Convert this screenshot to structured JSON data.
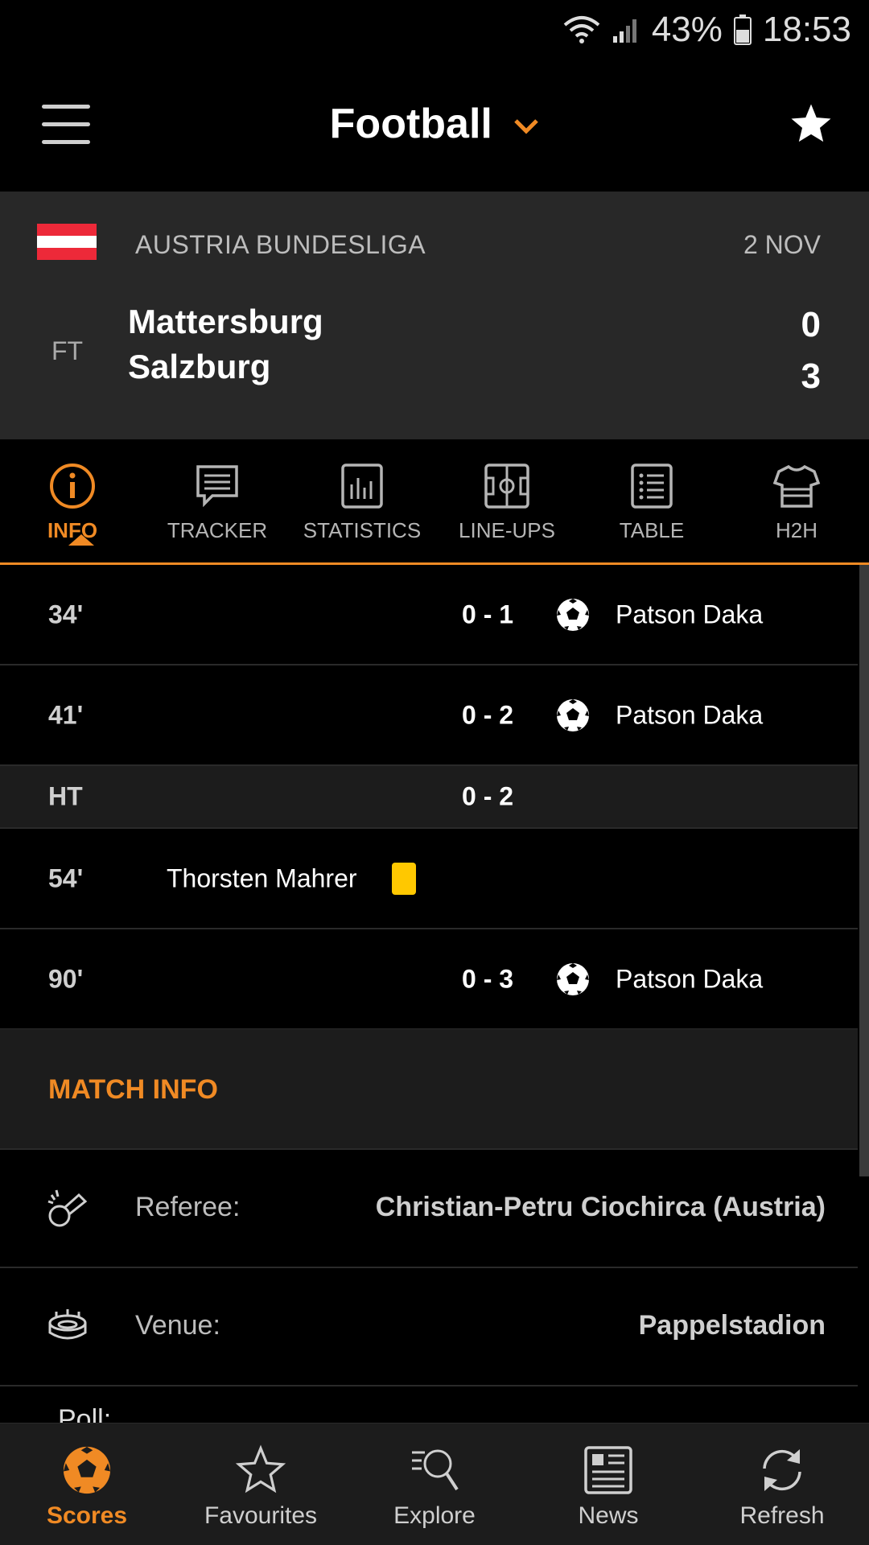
{
  "status_bar": {
    "battery": "43%",
    "time": "18:53"
  },
  "app_bar": {
    "title": "Football"
  },
  "match": {
    "league": "AUSTRIA BUNDESLIGA",
    "date": "2 NOV",
    "status": "FT",
    "home_team": "Mattersburg",
    "away_team": "Salzburg",
    "home_score": "0",
    "away_score": "3",
    "flag_colors": [
      "#ED2939",
      "#FFFFFF",
      "#ED2939"
    ]
  },
  "tabs": [
    {
      "label": "INFO",
      "icon": "info-icon",
      "active": true
    },
    {
      "label": "TRACKER",
      "icon": "chat-bubble-icon",
      "active": false
    },
    {
      "label": "STATISTICS",
      "icon": "bar-chart-icon",
      "active": false
    },
    {
      "label": "LINE-UPS",
      "icon": "pitch-icon",
      "active": false
    },
    {
      "label": "TABLE",
      "icon": "list-icon",
      "active": false
    },
    {
      "label": "H2H",
      "icon": "jersey-icon",
      "active": false
    }
  ],
  "events": [
    {
      "minute": "34'",
      "score": "0 - 1",
      "type": "goal",
      "player": "Patson Daka"
    },
    {
      "minute": "41'",
      "score": "0 - 2",
      "type": "goal",
      "player": "Patson Daka"
    },
    {
      "minute": "HT",
      "score": "0 - 2",
      "type": "halftime"
    },
    {
      "minute": "54'",
      "type": "yellow-card",
      "player": "Thorsten Mahrer"
    },
    {
      "minute": "90'",
      "score": "0 - 3",
      "type": "goal",
      "player": "Patson Daka"
    }
  ],
  "match_info": {
    "heading": "MATCH INFO",
    "referee_label": "Referee:",
    "referee_value": "Christian-Petru Ciochirca (Austria)",
    "venue_label": "Venue:",
    "venue_value": "Pappelstadion",
    "poll_label": "Poll:"
  },
  "bottom_nav": [
    {
      "label": "Scores",
      "icon": "soccer-ball-icon",
      "active": true
    },
    {
      "label": "Favourites",
      "icon": "star-outline-icon",
      "active": false
    },
    {
      "label": "Explore",
      "icon": "explore-search-icon",
      "active": false
    },
    {
      "label": "News",
      "icon": "newspaper-icon",
      "active": false
    },
    {
      "label": "Refresh",
      "icon": "refresh-icon",
      "active": false
    }
  ],
  "colors": {
    "accent": "#F08A24",
    "yellow_card": "#FFC800",
    "header_bg": "#282828"
  }
}
